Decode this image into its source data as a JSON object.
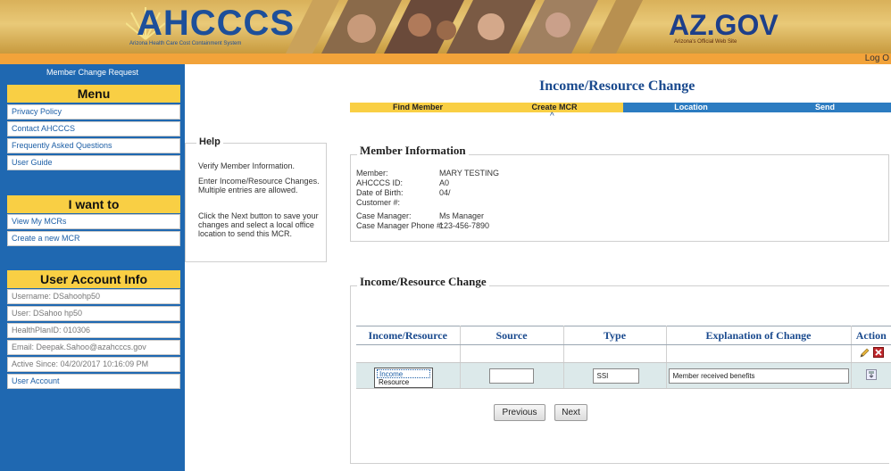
{
  "banner": {
    "ahcccs_logo_text": "AHCCCS",
    "ahcccs_subtitle": "Arizona Health Care Cost Containment System",
    "azgov_logo_text": "AZ.GOV",
    "azgov_subtitle": "Arizona's Official Web Site"
  },
  "topbar": {
    "logout_label": "Log O"
  },
  "sidebar": {
    "title": "Member Change Request",
    "menu_header": "Menu",
    "menu_items": [
      {
        "label": "Privacy Policy"
      },
      {
        "label": "Contact AHCCCS"
      },
      {
        "label": "Frequently Asked Questions"
      },
      {
        "label": "User Guide"
      }
    ],
    "iwant_header": "I want to",
    "iwant_items": [
      {
        "label": "View My MCRs"
      },
      {
        "label": "Create a new MCR"
      }
    ],
    "account_header": "User Account Info",
    "account_items": [
      {
        "label": "Username: DSahoohp50"
      },
      {
        "label": "User: DSahoo hp50"
      },
      {
        "label": "HealthPlanID: 010306"
      },
      {
        "label": "Email: Deepak.Sahoo@azahcccs.gov"
      },
      {
        "label": "Active Since: 04/20/2017 10:16:09 PM"
      }
    ],
    "user_account_link": "User Account"
  },
  "help": {
    "title": "Help",
    "paragraphs": [
      "Verify Member Information.",
      "Enter Income/Resource Changes. Multiple entries are allowed.",
      "Click the Next button to save your changes and select a local office location to send this MCR."
    ]
  },
  "page": {
    "title": "Income/Resource Change"
  },
  "steps": [
    {
      "label": "Find Member",
      "state": "done"
    },
    {
      "label": "Create MCR",
      "state": "current"
    },
    {
      "label": "Location",
      "state": "pending"
    },
    {
      "label": "Send",
      "state": "pending"
    }
  ],
  "step_caret": "^",
  "member_info": {
    "title": "Member Information",
    "fields": [
      {
        "label": "Member:",
        "value": "MARY TESTING"
      },
      {
        "label": "AHCCCS ID:",
        "value": "A0"
      },
      {
        "label": "Date of Birth:",
        "value": "04/"
      },
      {
        "label": "Customer #:",
        "value": ""
      },
      {
        "label": "Case Manager:",
        "value": "Ms Manager"
      },
      {
        "label": "Case Manager Phone #:",
        "value": "123-456-7890"
      }
    ]
  },
  "income_resource": {
    "title": "Income/Resource Change",
    "columns": [
      "Income/Resource",
      "Source",
      "Type",
      "Explanation of Change",
      "Action"
    ],
    "edit_row": {
      "options": [
        "Income",
        "Resource"
      ],
      "selected": "Income",
      "source": "",
      "type": "SSI",
      "explanation": "Member received benefits"
    }
  },
  "buttons": {
    "previous": "Previous",
    "next": "Next"
  },
  "colors": {
    "sidebar_blue": "#1f68b1",
    "accent_yellow": "#f9cf44",
    "step_blue": "#2c7cc1",
    "title_blue": "#1a4a8e"
  }
}
